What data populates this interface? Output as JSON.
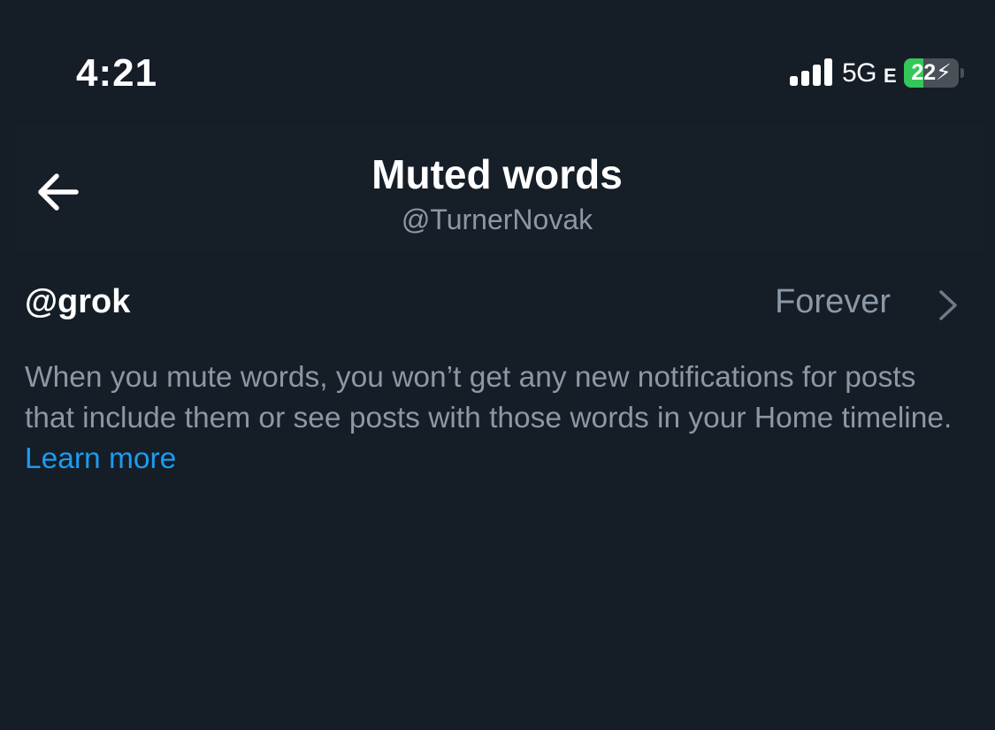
{
  "status_bar": {
    "time": "4:21",
    "network": "5G",
    "network_secondary": "E",
    "battery_percent": "22",
    "battery_level": 0.22,
    "battery_charging": true,
    "signal_bars": 4
  },
  "header": {
    "title": "Muted words",
    "subtitle": "@TurnerNovak",
    "back_icon": "arrow-left-icon"
  },
  "muted_words": [
    {
      "word": "@grok",
      "duration": "Forever",
      "chevron_icon": "chevron-right-icon"
    }
  ],
  "info": {
    "text": "When you mute words, you won’t get any new notifications for posts that include them or see posts with those words in your Home timeline.",
    "link_label": "Learn more"
  },
  "colors": {
    "background": "#151d27",
    "primary_text": "#ffffff",
    "secondary_text": "#8b98a5",
    "link": "#1d9bf0",
    "battery_green": "#34c759"
  }
}
